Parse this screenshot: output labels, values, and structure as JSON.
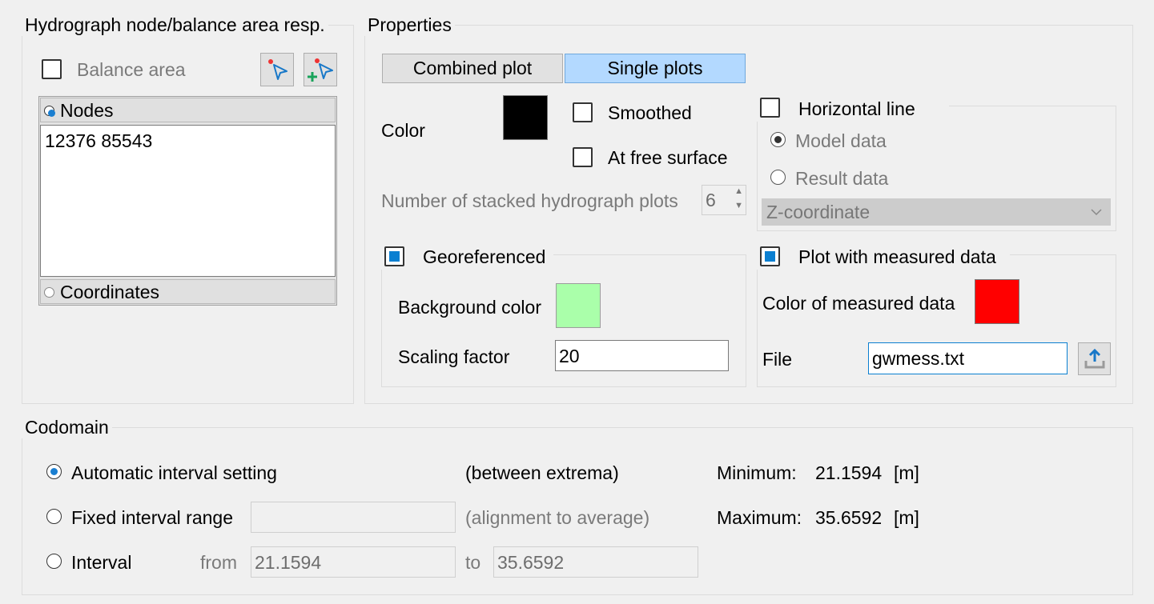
{
  "left_group": {
    "title": "Hydrograph node/balance area resp.",
    "balance_area_label": "Balance area",
    "balance_area_checked": false,
    "select_icon": "pointer-select-icon",
    "add_select_icon": "pointer-add-icon",
    "nodes_label": "Nodes",
    "nodes_value": "12376 85543",
    "coordinates_label": "Coordinates",
    "selected_mode": "Nodes"
  },
  "properties": {
    "title": "Properties",
    "combined_plot_label": "Combined plot",
    "single_plots_label": "Single plots",
    "active_tab": "Single plots",
    "color_label": "Color",
    "color_value": "#000000",
    "smoothed_label": "Smoothed",
    "at_free_surface_label": "At free surface",
    "stacked_label": "Number of stacked hydrograph plots",
    "stacked_value": "6",
    "horizontal_line": {
      "label": "Horizontal line",
      "model_data_label": "Model data",
      "result_data_label": "Result data",
      "selected": "Model data",
      "dropdown_value": "Z-coordinate"
    },
    "georeferenced": {
      "label": "Georeferenced",
      "checked": true,
      "background_color_label": "Background color",
      "background_color_value": "#aaffaa",
      "scaling_factor_label": "Scaling factor",
      "scaling_factor_value": "20"
    },
    "measured": {
      "label": "Plot with measured data",
      "checked": true,
      "color_label": "Color of measured data",
      "color_value": "#ff0000",
      "file_label": "File",
      "file_value": "gwmess.txt",
      "browse_icon": "upload-file-icon"
    }
  },
  "codomain": {
    "title": "Codomain",
    "automatic_label": "Automatic interval setting",
    "automatic_note": "(between extrema)",
    "fixed_label": "Fixed interval range",
    "fixed_value": "",
    "fixed_note": "(alignment to average)",
    "interval_label": "Interval",
    "from_label": "from",
    "from_value": "21.1594",
    "to_label": "to",
    "to_value": "35.6592",
    "selected": "Automatic interval setting",
    "minimum_label": "Minimum:",
    "minimum_value": "21.1594",
    "maximum_label": "Maximum:",
    "maximum_value": "35.6592",
    "unit": "[m]"
  },
  "colors": {
    "accent": "#0a7fd1",
    "tab_active": "#b3d9ff"
  }
}
